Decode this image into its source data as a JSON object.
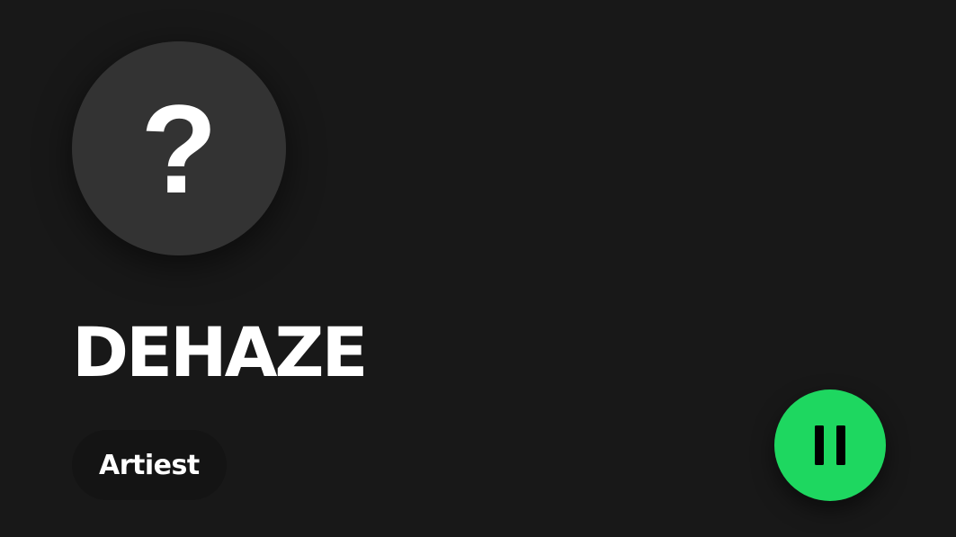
{
  "artist": {
    "image_placeholder": "?",
    "name": "DEHAZE",
    "type_label": "Artiest"
  },
  "controls": {
    "playback_icon": "pause-icon",
    "accent_color": "#1ed760"
  },
  "colors": {
    "background": "#181818",
    "avatar_fill": "#333333",
    "badge_fill": "#141414",
    "text": "#ffffff"
  }
}
